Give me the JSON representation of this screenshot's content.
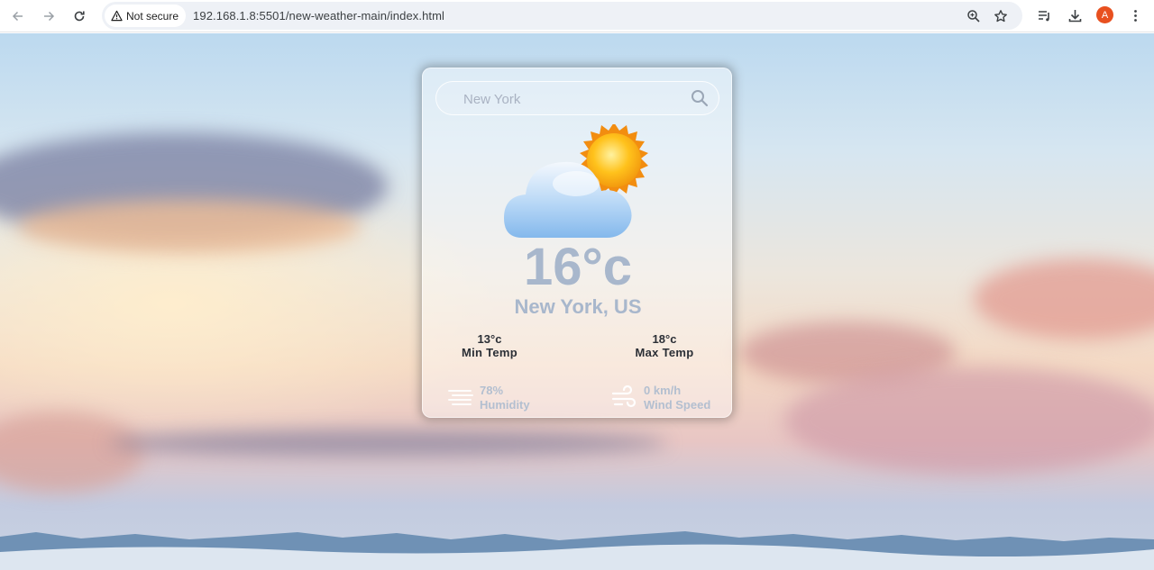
{
  "browser": {
    "security_label": "Not secure",
    "url": "192.168.1.8:5501/new-weather-main/index.html",
    "profile_initial": "A"
  },
  "search": {
    "placeholder": "New York"
  },
  "weather": {
    "temperature": "16°c",
    "location": "New York, US",
    "condition_icon": "partly-cloudy-icon",
    "min_temp": {
      "value": "13°c",
      "label": "Min Temp"
    },
    "max_temp": {
      "value": "18°c",
      "label": "Max Temp"
    },
    "humidity": {
      "value": "78%",
      "label": "Humidity",
      "icon": "humidity-icon"
    },
    "wind": {
      "value": "0 km/h",
      "label": "Wind Speed",
      "icon": "wind-icon"
    }
  },
  "colors": {
    "text_muted": "#a8b7cc",
    "text_dark": "#2b2f36",
    "avatar": "#e8501f"
  }
}
